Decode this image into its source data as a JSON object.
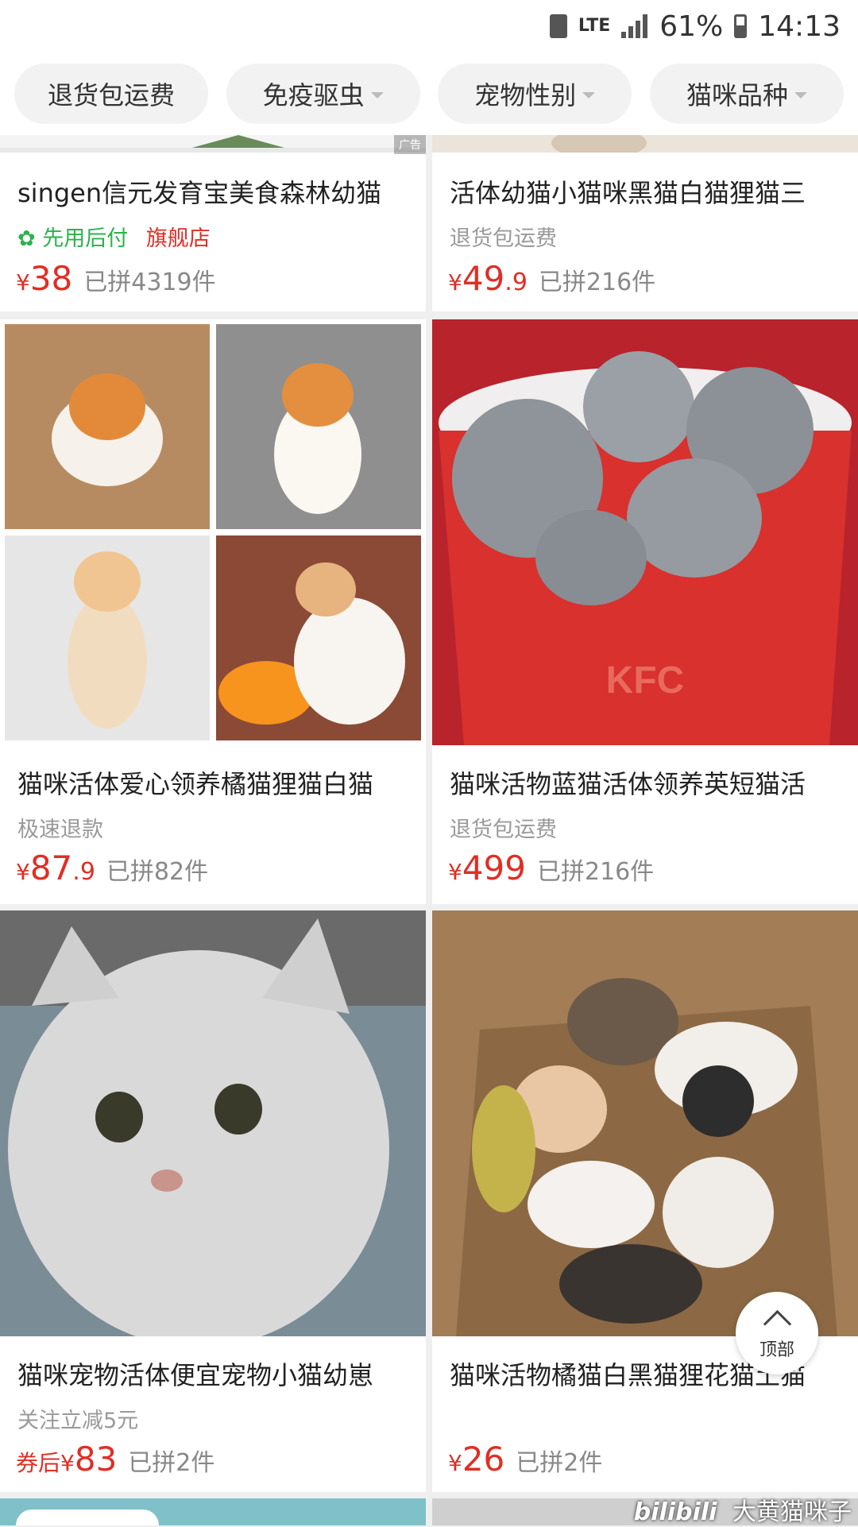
{
  "status": {
    "network": "LTE",
    "battery": "61%",
    "time": "14:13"
  },
  "filters": [
    {
      "label": "退货包运费",
      "dropdown": false
    },
    {
      "label": "免疫驱虫",
      "dropdown": true
    },
    {
      "label": "宠物性别",
      "dropdown": true
    },
    {
      "label": "猫咪品种",
      "dropdown": true
    }
  ],
  "products": {
    "p1": {
      "title": "singen信元发育宝美食森林幼猫",
      "tag_green": "先用后付",
      "tag_red": "旗舰店",
      "price_int": "38",
      "price_dec": "",
      "sold": "已拼4319件",
      "ad": "广告"
    },
    "p2": {
      "title": "活体幼猫小猫咪黑猫白猫狸猫三",
      "tag": "退货包运费",
      "price_int": "49",
      "price_dec": ".9",
      "sold": "已拼216件"
    },
    "p3": {
      "title": "猫咪活体爱心领养橘猫狸猫白猫",
      "tag": "极速退款",
      "price_int": "87",
      "price_dec": ".9",
      "sold": "已拼82件"
    },
    "p4": {
      "title": "猫咪活物蓝猫活体领养英短猫活",
      "tag": "退货包运费",
      "price_int": "499",
      "price_dec": "",
      "sold": "已拼216件",
      "bucket_text": "KFC"
    },
    "p5": {
      "title": "猫咪宠物活体便宜宠物小猫幼崽",
      "tag": "关注立减5元",
      "price_prefix": "券后",
      "price_int": "83",
      "price_dec": "",
      "sold": "已拼2件"
    },
    "p6": {
      "title": "猫咪活物橘猫白黑猫狸花猫土猫",
      "price_int": "26",
      "price_dec": "",
      "sold": "已拼2件"
    }
  },
  "currency": "¥",
  "back_to_top": "顶部",
  "watermark": {
    "logo": "bilibili",
    "text": "大黄猫咪子"
  },
  "colors": {
    "price": "#e02e24",
    "green_tag": "#2bb24c",
    "muted": "#999999"
  }
}
